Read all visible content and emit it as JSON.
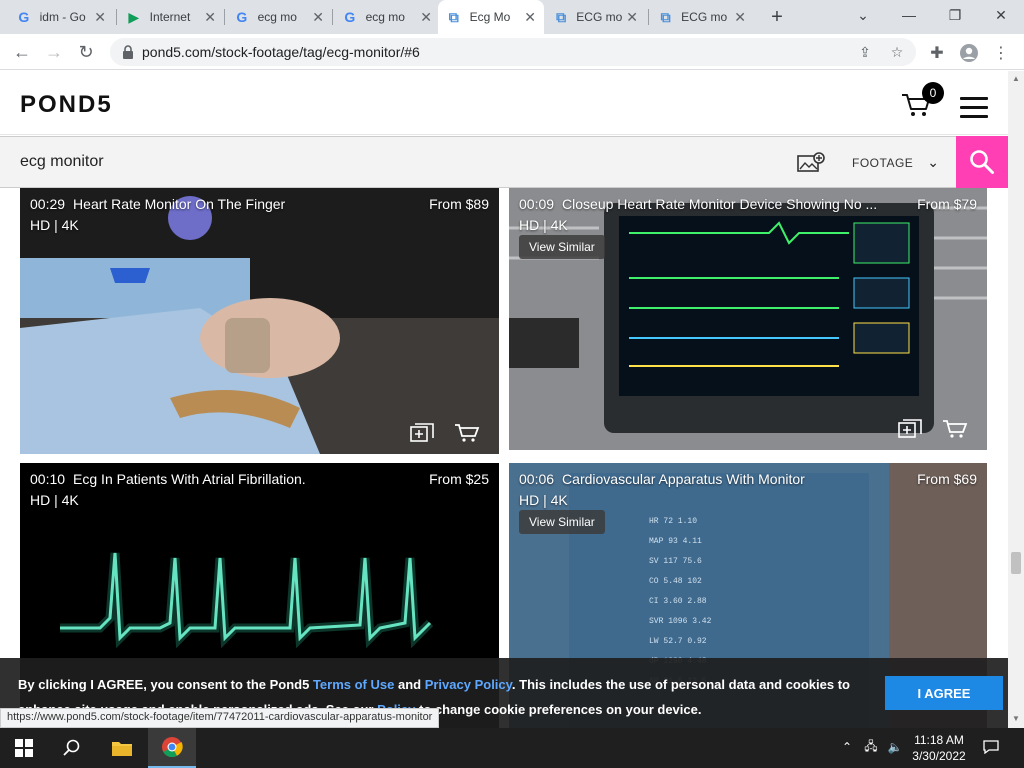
{
  "browser": {
    "tabs": [
      {
        "title": "idm - Go",
        "favicon": "google-icon",
        "active": false
      },
      {
        "title": "Internet",
        "favicon": "play-icon",
        "active": false
      },
      {
        "title": "ecg mo",
        "favicon": "google-icon",
        "active": false
      },
      {
        "title": "ecg mo",
        "favicon": "google-icon",
        "active": false
      },
      {
        "title": "Ecg Mo",
        "favicon": "pond5-icon",
        "active": true
      },
      {
        "title": "ECG mo",
        "favicon": "pond5-icon",
        "active": false
      },
      {
        "title": "ECG mo",
        "favicon": "pond5-icon",
        "active": false
      }
    ],
    "url": "pond5.com/stock-footage/tag/ecg-monitor/#6",
    "status_url": "https://www.pond5.com/stock-footage/item/77472011-cardiovascular-apparatus-monitor"
  },
  "site": {
    "logo": "POND5",
    "cart_count": "0",
    "search_query": "ecg monitor",
    "media_type": "FOOTAGE"
  },
  "results": [
    {
      "duration": "00:29",
      "title": "Heart Rate Monitor On The Finger",
      "quality": "HD | 4K",
      "price": "From $89",
      "view_similar": ""
    },
    {
      "duration": "00:09",
      "title": "Closeup Heart Rate Monitor Device Showing No ...",
      "quality": "HD | 4K",
      "price": "From $79",
      "view_similar": "View Similar"
    },
    {
      "duration": "00:10",
      "title": "Ecg In Patients With Atrial Fibrillation.",
      "quality": "HD | 4K",
      "price": "From $25",
      "view_similar": ""
    },
    {
      "duration": "00:06",
      "title": "Cardiovascular Apparatus With Monitor",
      "quality": "HD | 4K",
      "price": "From $69",
      "view_similar": "View Similar"
    }
  ],
  "cookie": {
    "part1": "By clicking I AGREE, you consent to the Pond5 ",
    "terms": "Terms of Use",
    "and": " and ",
    "privacy": "Privacy Policy",
    "part2": ". This includes the use of personal data and cookies to enhance site usage and enable personalized ads. See our ",
    "policy": "Policy",
    "part3": " to change cookie preferences on your device.",
    "agree": "I AGREE"
  },
  "taskbar": {
    "time": "11:18 AM",
    "date": "3/30/2022"
  },
  "colors": {
    "search_button": "#ff3fb3",
    "agree_button": "#1e88e5",
    "link": "#5ea8ff"
  }
}
